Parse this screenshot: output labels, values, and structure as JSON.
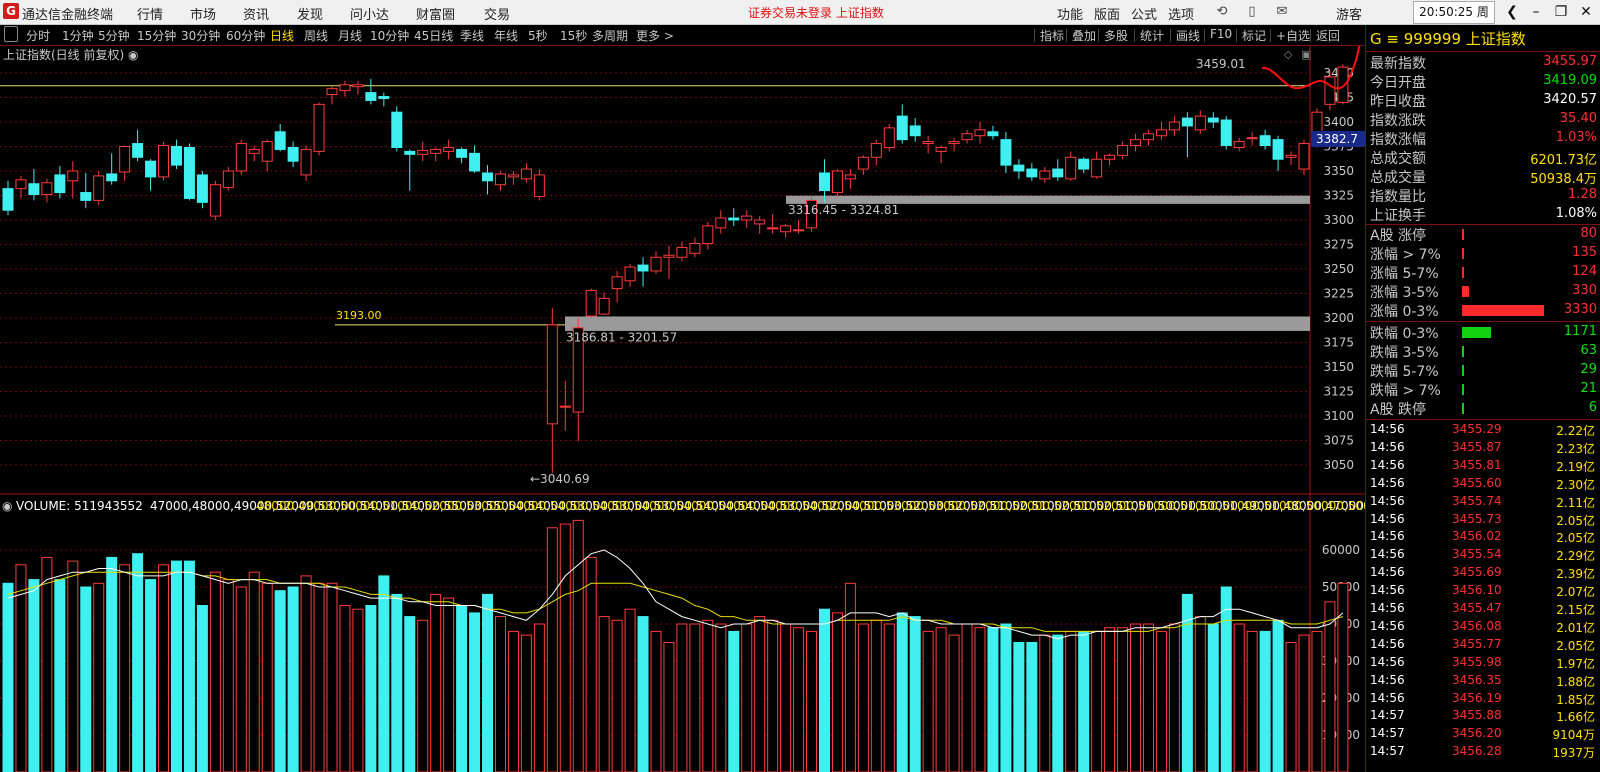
{
  "app": {
    "title": "通达信金融终端",
    "logo": "G"
  },
  "menu": [
    "行情",
    "市场",
    "资讯",
    "发现",
    "问小达",
    "财富圈",
    "交易"
  ],
  "status": "证券交易未登录  上证指数",
  "toolbar_right": [
    "功能",
    "版面",
    "公式",
    "选项"
  ],
  "user_label": "游客",
  "clock": "20:50:25 周三",
  "periods": {
    "items": [
      "分时",
      "1分钟",
      "5分钟",
      "15分钟",
      "30分钟",
      "60分钟",
      "日线",
      "周线",
      "月线",
      "10分钟",
      "45日线",
      "季线",
      "年线",
      "5秒",
      "15秒",
      "多周期",
      "更多 >"
    ],
    "active": "日线"
  },
  "tools": [
    "指标",
    "叠加",
    "多股",
    "统计",
    "画线",
    "F10",
    "标记",
    "+自选",
    "返回"
  ],
  "chart_title": "上证指数(日线 前复权)",
  "candles": {
    "price_axis": [
      3450,
      3425,
      3400,
      3375,
      3350,
      3325,
      3300,
      3275,
      3250,
      3225,
      3200,
      3175,
      3150,
      3125,
      3100,
      3075,
      3050
    ],
    "last_price_tag": "3382.7",
    "annotations": {
      "high": "3459.01",
      "low": "←3040.69",
      "support": "3193.00",
      "gap1": "3186.81 - 3201.57",
      "gap2": "3316.45 - 3324.81"
    },
    "ohlc": [
      [
        3332,
        3340,
        3305,
        3310
      ],
      [
        3332,
        3345,
        3322,
        3341
      ],
      [
        3337,
        3352,
        3320,
        3326
      ],
      [
        3326,
        3342,
        3318,
        3338
      ],
      [
        3346,
        3355,
        3322,
        3328
      ],
      [
        3340,
        3360,
        3322,
        3350
      ],
      [
        3328,
        3348,
        3312,
        3320
      ],
      [
        3320,
        3350,
        3315,
        3345
      ],
      [
        3347,
        3368,
        3336,
        3340
      ],
      [
        3349,
        3376,
        3340,
        3375
      ],
      [
        3378,
        3392,
        3360,
        3364
      ],
      [
        3360,
        3362,
        3330,
        3344
      ],
      [
        3344,
        3380,
        3340,
        3376
      ],
      [
        3375,
        3382,
        3352,
        3356
      ],
      [
        3374,
        3378,
        3320,
        3322
      ],
      [
        3346,
        3350,
        3312,
        3318
      ],
      [
        3304,
        3340,
        3300,
        3336
      ],
      [
        3333,
        3354,
        3330,
        3350
      ],
      [
        3350,
        3382,
        3346,
        3378
      ],
      [
        3368,
        3376,
        3360,
        3372
      ],
      [
        3360,
        3382,
        3350,
        3380
      ],
      [
        3390,
        3398,
        3370,
        3372
      ],
      [
        3374,
        3380,
        3354,
        3360
      ],
      [
        3346,
        3376,
        3340,
        3372
      ],
      [
        3370,
        3420,
        3366,
        3418
      ],
      [
        3428,
        3436,
        3418,
        3434
      ],
      [
        3432,
        3442,
        3426,
        3438
      ],
      [
        3436,
        3442,
        3428,
        3438
      ],
      [
        3430,
        3444,
        3418,
        3422
      ],
      [
        3426,
        3430,
        3416,
        3424
      ],
      [
        3410,
        3416,
        3370,
        3374
      ],
      [
        3370,
        3372,
        3330,
        3367
      ],
      [
        3367,
        3380,
        3360,
        3371
      ],
      [
        3368,
        3374,
        3360,
        3372
      ],
      [
        3370,
        3382,
        3362,
        3374
      ],
      [
        3372,
        3374,
        3358,
        3364
      ],
      [
        3368,
        3376,
        3348,
        3350
      ],
      [
        3348,
        3356,
        3326,
        3340
      ],
      [
        3336,
        3350,
        3330,
        3347
      ],
      [
        3344,
        3350,
        3336,
        3346
      ],
      [
        3342,
        3358,
        3338,
        3352
      ],
      [
        3324,
        3352,
        3320,
        3346
      ],
      [
        3092,
        3210,
        3042,
        3193
      ],
      [
        3109,
        3136,
        3085,
        3110
      ],
      [
        3104,
        3200,
        3074,
        3190
      ],
      [
        3202,
        3230,
        3200,
        3228
      ],
      [
        3204,
        3226,
        3203,
        3220
      ],
      [
        3230,
        3248,
        3216,
        3242
      ],
      [
        3238,
        3255,
        3232,
        3252
      ],
      [
        3254,
        3262,
        3232,
        3248
      ],
      [
        3248,
        3268,
        3245,
        3262
      ],
      [
        3262,
        3274,
        3240,
        3264
      ],
      [
        3262,
        3278,
        3258,
        3272
      ],
      [
        3266,
        3282,
        3262,
        3276
      ],
      [
        3276,
        3298,
        3270,
        3294
      ],
      [
        3292,
        3310,
        3286,
        3302
      ],
      [
        3302,
        3312,
        3294,
        3300
      ],
      [
        3300,
        3310,
        3292,
        3304
      ],
      [
        3296,
        3304,
        3286,
        3300
      ],
      [
        3292,
        3306,
        3286,
        3292
      ],
      [
        3288,
        3296,
        3282,
        3294
      ],
      [
        3290,
        3300,
        3286,
        3290
      ],
      [
        3292,
        3324,
        3288,
        3320
      ],
      [
        3348,
        3362,
        3318,
        3330
      ],
      [
        3328,
        3352,
        3324,
        3350
      ],
      [
        3342,
        3352,
        3332,
        3346
      ],
      [
        3352,
        3366,
        3346,
        3364
      ],
      [
        3364,
        3382,
        3356,
        3378
      ],
      [
        3374,
        3398,
        3370,
        3394
      ],
      [
        3406,
        3418,
        3378,
        3382
      ],
      [
        3396,
        3404,
        3380,
        3386
      ],
      [
        3378,
        3386,
        3368,
        3380
      ],
      [
        3370,
        3376,
        3358,
        3374
      ],
      [
        3378,
        3384,
        3370,
        3380
      ],
      [
        3382,
        3392,
        3378,
        3388
      ],
      [
        3386,
        3400,
        3378,
        3392
      ],
      [
        3390,
        3396,
        3382,
        3386
      ],
      [
        3382,
        3390,
        3348,
        3356
      ],
      [
        3356,
        3362,
        3342,
        3350
      ],
      [
        3352,
        3358,
        3340,
        3344
      ],
      [
        3342,
        3354,
        3338,
        3350
      ],
      [
        3352,
        3362,
        3340,
        3344
      ],
      [
        3342,
        3370,
        3340,
        3364
      ],
      [
        3362,
        3364,
        3348,
        3352
      ],
      [
        3344,
        3370,
        3342,
        3362
      ],
      [
        3362,
        3368,
        3356,
        3366
      ],
      [
        3366,
        3380,
        3362,
        3376
      ],
      [
        3376,
        3388,
        3370,
        3382
      ],
      [
        3382,
        3392,
        3376,
        3388
      ],
      [
        3386,
        3400,
        3382,
        3392
      ],
      [
        3392,
        3406,
        3386,
        3400
      ],
      [
        3404,
        3410,
        3364,
        3396
      ],
      [
        3392,
        3412,
        3388,
        3406
      ],
      [
        3404,
        3410,
        3394,
        3400
      ],
      [
        3402,
        3406,
        3372,
        3376
      ],
      [
        3374,
        3384,
        3370,
        3380
      ],
      [
        3384,
        3390,
        3376,
        3384
      ],
      [
        3386,
        3392,
        3372,
        3376
      ],
      [
        3382,
        3386,
        3350,
        3362
      ],
      [
        3364,
        3370,
        3356,
        3366
      ],
      [
        3352,
        3382,
        3346,
        3378
      ],
      [
        3378,
        3414,
        3374,
        3410
      ],
      [
        3418,
        3452,
        3412,
        3446
      ],
      [
        3420,
        3459,
        3418,
        3456
      ]
    ]
  },
  "volume": {
    "title": "VOLUME: 511943552",
    "ma5": [
      47000,
      48000,
      49000,
      52000,
      53000,
      54000,
      54000,
      55000,
      55000,
      54000,
      53000,
      53000,
      53000,
      54000,
      54000,
      53000,
      52000,
      51000,
      52000,
      52000,
      51000,
      51000,
      51000,
      51000,
      50000,
      50000,
      49000,
      48000,
      47000,
      47000,
      47000,
      46000,
      46000,
      45000,
      45000,
      45000,
      45000,
      44000,
      43000,
      42000,
      41000,
      44000,
      48000,
      53000,
      56000,
      59000,
      60000,
      58000,
      55000,
      51000,
      46000,
      44000,
      42000,
      41000,
      40000,
      39000,
      40000,
      40000,
      41000,
      41000,
      40000,
      40000,
      40000,
      40000,
      41000,
      43000,
      43000,
      43000,
      42000,
      43000,
      41000,
      41000,
      40000,
      40000,
      40000,
      40000,
      39000,
      39000,
      38000,
      37000,
      37000,
      36000,
      37000,
      37000,
      38000,
      38000,
      38000,
      39000,
      39000,
      39000,
      40000,
      41000,
      42000,
      42000,
      44000,
      44000,
      43000,
      42000,
      41000,
      39000,
      39000,
      39000,
      40000,
      43000
    ],
    "ma10": [
      48000,
      49000,
      50000,
      51000,
      52000,
      53000,
      54000,
      54000,
      54000,
      54000,
      54000,
      54000,
      54000,
      54000,
      54000,
      53000,
      53000,
      52000,
      52000,
      52000,
      52000,
      51000,
      51000,
      51000,
      51000,
      50000,
      50000,
      49000,
      48000,
      48000,
      47000,
      47000,
      46000,
      46000,
      46000,
      45000,
      45000,
      44000,
      44000,
      43000,
      43000,
      44000,
      46000,
      48000,
      49000,
      51000,
      51000,
      51000,
      51000,
      50000,
      49000,
      48000,
      47000,
      45000,
      44000,
      42000,
      42000,
      41000,
      41000,
      40000,
      40000,
      40000,
      40000,
      40000,
      41000,
      41000,
      41000,
      41000,
      41000,
      42000,
      41000,
      41000,
      41000,
      40000,
      40000,
      40000,
      40000,
      39000,
      39000,
      39000,
      38000,
      38000,
      38000,
      38000,
      38000,
      38000,
      38000,
      38000,
      38000,
      39000,
      39000,
      40000,
      40000,
      40000,
      41000,
      41000,
      41000,
      41000,
      41000,
      40000,
      40000,
      40000,
      41000,
      42000
    ],
    "axis": [
      60000,
      50000,
      40000,
      30000,
      20000,
      10000
    ],
    "bars": [
      51000,
      56000,
      52000,
      58000,
      52000,
      57000,
      50000,
      51000,
      58000,
      56000,
      59000,
      52000,
      56000,
      57000,
      57000,
      45000,
      54000,
      52000,
      50000,
      54000,
      51000,
      49000,
      50000,
      53000,
      51000,
      51000,
      45000,
      44000,
      45000,
      53000,
      48000,
      42000,
      41000,
      48000,
      47000,
      45000,
      43000,
      48000,
      42000,
      38000,
      37000,
      40000,
      66000,
      67000,
      68000,
      58000,
      42000,
      41000,
      44000,
      42000,
      38000,
      35000,
      40000,
      40000,
      41000,
      40000,
      38000,
      40000,
      42000,
      41000,
      40000,
      39000,
      38000,
      44000,
      43000,
      51000,
      40000,
      41000,
      40000,
      43000,
      42000,
      38000,
      39000,
      37000,
      40000,
      39000,
      39000,
      40000,
      35000,
      35000,
      37000,
      37000,
      38000,
      38000,
      38000,
      39000,
      39000,
      40000,
      40000,
      38000,
      40000,
      48000,
      42000,
      40000,
      50000,
      40000,
      38000,
      38000,
      41000,
      35000,
      37000,
      38000,
      46000,
      51000
    ]
  },
  "rpanel": {
    "code_line": "G ≡ 999999 上证指数",
    "stats": [
      {
        "label": "最新指数",
        "value": "3455.97",
        "color": "#ff3030"
      },
      {
        "label": "今日开盘",
        "value": "3419.09",
        "color": "#00e000"
      },
      {
        "label": "昨日收盘",
        "value": "3420.57",
        "color": "#ffffff"
      },
      {
        "label": "指数涨跌",
        "value": "35.40",
        "color": "#ff3030"
      },
      {
        "label": "指数涨幅",
        "value": "1.03%",
        "color": "#ff3030"
      },
      {
        "label": "总成交额",
        "value": "6201.73亿",
        "color": "#ffe100"
      },
      {
        "label": "总成交量",
        "value": "50938.4万",
        "color": "#ffe100"
      },
      {
        "label": "指数量比",
        "value": "1.28",
        "color": "#ff3030"
      },
      {
        "label": "上证换手",
        "value": "1.08%",
        "color": "#ffffff"
      }
    ],
    "dist_up": [
      {
        "label": "A股 涨停",
        "value": "80",
        "frac": 0.0
      },
      {
        "label": "涨幅 > 7%",
        "value": "135",
        "frac": 0.03
      },
      {
        "label": "涨幅 5-7%",
        "value": "124",
        "frac": 0.03
      },
      {
        "label": "涨幅 3-5%",
        "value": "330",
        "frac": 0.09
      },
      {
        "label": "涨幅 0-3%",
        "value": "3330",
        "frac": 1.0
      }
    ],
    "dist_down": [
      {
        "label": "跌幅 0-3%",
        "value": "1171",
        "frac": 0.35
      },
      {
        "label": "跌幅 3-5%",
        "value": "63",
        "frac": 0.0
      },
      {
        "label": "跌幅 5-7%",
        "value": "29",
        "frac": 0.0
      },
      {
        "label": "跌幅 > 7%",
        "value": "21",
        "frac": 0.0
      },
      {
        "label": "A股 跌停",
        "value": "6",
        "frac": 0.0
      }
    ],
    "ticks": [
      {
        "t": "14:56",
        "p": "3455.29",
        "v": "2.22亿"
      },
      {
        "t": "14:56",
        "p": "3455.87",
        "v": "2.23亿"
      },
      {
        "t": "14:56",
        "p": "3455.81",
        "v": "2.19亿"
      },
      {
        "t": "14:56",
        "p": "3455.60",
        "v": "2.30亿"
      },
      {
        "t": "14:56",
        "p": "3455.74",
        "v": "2.11亿"
      },
      {
        "t": "14:56",
        "p": "3455.73",
        "v": "2.05亿"
      },
      {
        "t": "14:56",
        "p": "3456.02",
        "v": "2.05亿"
      },
      {
        "t": "14:56",
        "p": "3455.54",
        "v": "2.29亿"
      },
      {
        "t": "14:56",
        "p": "3455.69",
        "v": "2.39亿"
      },
      {
        "t": "14:56",
        "p": "3456.10",
        "v": "2.07亿"
      },
      {
        "t": "14:56",
        "p": "3455.47",
        "v": "2.15亿"
      },
      {
        "t": "14:56",
        "p": "3456.08",
        "v": "2.01亿"
      },
      {
        "t": "14:56",
        "p": "3455.77",
        "v": "2.05亿"
      },
      {
        "t": "14:56",
        "p": "3455.98",
        "v": "1.97亿"
      },
      {
        "t": "14:56",
        "p": "3456.35",
        "v": "1.88亿"
      },
      {
        "t": "14:56",
        "p": "3456.19",
        "v": "1.85亿"
      },
      {
        "t": "14:57",
        "p": "3455.88",
        "v": "1.66亿"
      },
      {
        "t": "14:57",
        "p": "3456.20",
        "v": "9104万"
      },
      {
        "t": "14:57",
        "p": "3456.28",
        "v": "1937万"
      }
    ]
  }
}
